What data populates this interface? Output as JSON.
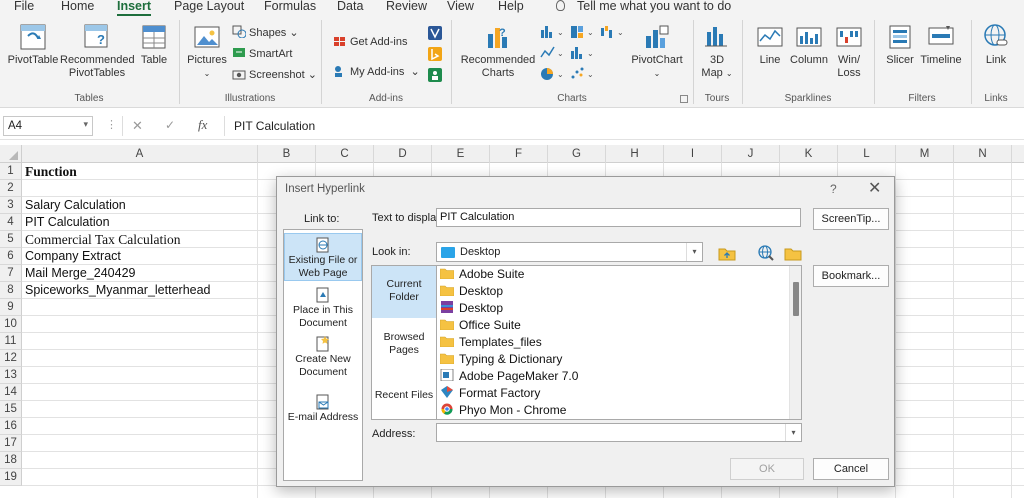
{
  "menu": [
    "File",
    "Home",
    "Insert",
    "Page Layout",
    "Formulas",
    "Data",
    "Review",
    "View",
    "Help"
  ],
  "tell_me": "Tell me what you want to do",
  "ribbon": {
    "tables": {
      "pivottable": "PivotTable",
      "recommended1": "Recommended",
      "recommended2": "PivotTables",
      "table": "Table",
      "group": "Tables"
    },
    "illustrations": {
      "pictures": "Pictures",
      "shapes": "Shapes",
      "smartart": "SmartArt",
      "screenshot": "Screenshot",
      "group": "Illustrations"
    },
    "addins": {
      "get": "Get Add-ins",
      "my": "My Add-ins",
      "group": "Add-ins"
    },
    "charts": {
      "recommended1": "Recommended",
      "recommended2": "Charts",
      "pivotchart": "PivotChart",
      "group": "Charts"
    },
    "tours": {
      "map1": "3D",
      "map2": "Map",
      "group": "Tours"
    },
    "sparklines": {
      "line": "Line",
      "column": "Column",
      "winloss1": "Win/",
      "winloss2": "Loss",
      "group": "Sparklines"
    },
    "filters": {
      "slicer": "Slicer",
      "timeline": "Timeline",
      "group": "Filters"
    },
    "links": {
      "link": "Link",
      "group": "Links"
    }
  },
  "namebox": "A4",
  "formula": "PIT Calculation",
  "columns": [
    "A",
    "B",
    "C",
    "D",
    "E",
    "F",
    "G",
    "H",
    "I",
    "J",
    "K",
    "L",
    "M",
    "N"
  ],
  "rows": [
    "1",
    "2",
    "3",
    "4",
    "5",
    "6",
    "7",
    "8",
    "9",
    "10",
    "11",
    "12",
    "13",
    "14",
    "15",
    "16",
    "17",
    "18",
    "19"
  ],
  "cells": [
    {
      "row": 1,
      "text": "Function"
    },
    {
      "row": 3,
      "text": "Salary Calculation"
    },
    {
      "row": 4,
      "text": "PIT Calculation"
    },
    {
      "row": 5,
      "text": "Commercial Tax Calculation"
    },
    {
      "row": 6,
      "text": "Company Extract"
    },
    {
      "row": 7,
      "text": "Mail Merge_240429"
    },
    {
      "row": 8,
      "text": "Spiceworks_Myanmar_letterhead"
    }
  ],
  "dialog": {
    "title": "Insert Hyperlink",
    "help": "?",
    "close": "✕",
    "link_to": "Link to:",
    "link_items": [
      [
        "Existing File or",
        "Web Page"
      ],
      [
        "Place in This",
        "Document"
      ],
      [
        "Create New",
        "Document"
      ],
      [
        "E-mail Address"
      ]
    ],
    "text_to_display_label": "Text to display:",
    "text_to_display": "PIT Calculation",
    "screentip": "ScreenTip...",
    "look_in_label": "Look in:",
    "look_in": "Desktop",
    "places": [
      [
        "Current",
        "Folder"
      ],
      [
        "Browsed",
        "Pages"
      ],
      [
        "Recent Files"
      ]
    ],
    "files": [
      {
        "name": "Adobe Suite",
        "icon": "folder-icon"
      },
      {
        "name": "Desktop",
        "icon": "folder-icon"
      },
      {
        "name": "Desktop",
        "icon": "winrar-archive-icon"
      },
      {
        "name": "Office Suite",
        "icon": "folder-icon"
      },
      {
        "name": "Templates_files",
        "icon": "folder-icon"
      },
      {
        "name": "Typing & Dictionary",
        "icon": "folder-icon"
      },
      {
        "name": "Adobe PageMaker 7.0",
        "icon": "pagemaker-shortcut-icon"
      },
      {
        "name": "Format Factory",
        "icon": "formatfactory-shortcut-icon"
      },
      {
        "name": "Phyo Mon - Chrome",
        "icon": "chrome-shortcut-icon"
      }
    ],
    "bookmark": "Bookmark...",
    "address_label": "Address:",
    "address": "",
    "ok": "OK",
    "cancel": "Cancel"
  },
  "colors": {
    "accent": "#1e6e3c",
    "selection": "#cce4f7",
    "folder": "#f5c242"
  }
}
